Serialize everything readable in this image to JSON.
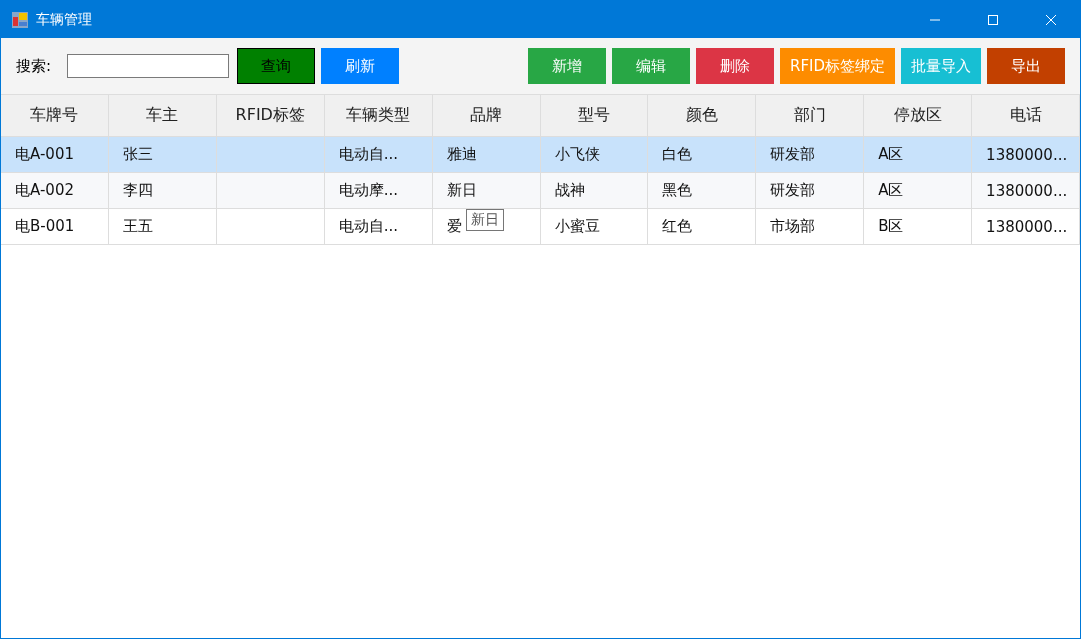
{
  "window": {
    "title": "车辆管理"
  },
  "search": {
    "label": "搜索:"
  },
  "buttons": [
    {
      "label": "查询",
      "color": "#008000",
      "focused": true
    },
    {
      "label": "刷新",
      "color": "#0080ff",
      "focused": false
    },
    {
      "label": "新增",
      "color": "#28a745",
      "focused": false
    },
    {
      "label": "编辑",
      "color": "#28a745",
      "focused": false
    },
    {
      "label": "删除",
      "color": "#dc3545",
      "focused": false
    },
    {
      "label": "RFID标签绑定",
      "color": "#fd8c00",
      "focused": false
    },
    {
      "label": "批量导入",
      "color": "#17bfd3",
      "focused": false
    },
    {
      "label": "导出",
      "color": "#c24000",
      "focused": false
    }
  ],
  "table": {
    "columns": [
      "车牌号",
      "车主",
      "RFID标签",
      "车辆类型",
      "品牌",
      "型号",
      "颜色",
      "部门",
      "停放区",
      "电话"
    ],
    "rows": [
      {
        "selected": true,
        "cells": [
          "电A-001",
          "张三",
          "",
          "电动自...",
          "雅迪",
          "小飞侠",
          "白色",
          "研发部",
          "A区",
          "1380000..."
        ]
      },
      {
        "selected": false,
        "cells": [
          "电A-002",
          "李四",
          "",
          "电动摩...",
          "新日",
          "战神",
          "黑色",
          "研发部",
          "A区",
          "1380000..."
        ]
      },
      {
        "selected": false,
        "cells": [
          "电B-001",
          "王五",
          "",
          "电动自...",
          "爱",
          "小蜜豆",
          "红色",
          "市场部",
          "B区",
          "1380000..."
        ]
      }
    ]
  },
  "tooltip": {
    "text": "新日"
  }
}
